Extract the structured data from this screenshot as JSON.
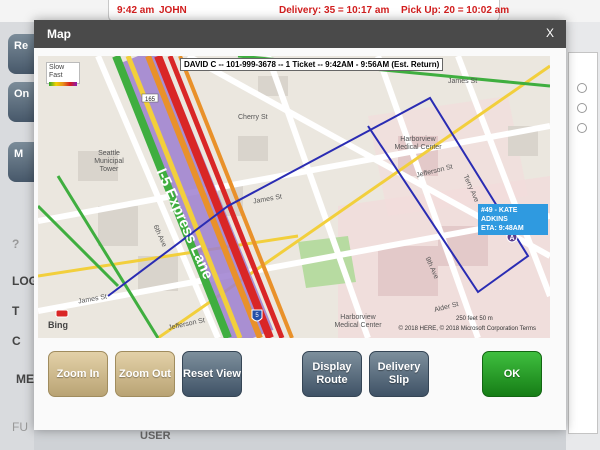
{
  "topbar": {
    "time": "9:42 am",
    "user": "JOHN",
    "delivery": "Delivery: 35 = 10:17 am",
    "pickup": "Pick Up: 20 = 10:02 am"
  },
  "background": {
    "btn1": "Re",
    "btn2": "On",
    "btn3": "M",
    "question": "?",
    "lbl_log": "LOG",
    "lbl_t": "T",
    "lbl_c": "C",
    "lbl_me": "ME",
    "lbl_fu": "FU",
    "bottom": "USER"
  },
  "modal": {
    "title": "Map",
    "close": "X"
  },
  "map": {
    "driver_label": "DAVID C -- 101-999-3678 -- 1 Ticket -- 9:42AM - 9:56AM (Est. Return)",
    "traffic_label": "Slow Fast",
    "eta_line1": "#49 - KATE ADKINS",
    "eta_line2": "ETA: 9:48AM",
    "marker": "A",
    "bing": "Bing",
    "copyright": "© 2018 HERE, © 2018 Microsoft Corporation  Terms",
    "scale": "250 feet        50 m",
    "streets": {
      "express": "I-5 Express Lane",
      "cherry": "Cherry St",
      "james_top": "James St",
      "james_mid": "James St",
      "james_bot": "James St",
      "jefferson": "Jefferson St",
      "jefferson_bot": "Jefferson St",
      "alder": "Alder St",
      "sixth": "6th Ave",
      "ninth": "9th Ave",
      "terry": "Terry Ave",
      "harborview": "Harborview Medical Center",
      "harborview2": "Harborview Medical Center",
      "tower": "Seattle Municipal Tower"
    },
    "shields": {
      "i5": "5",
      "r165": "165"
    }
  },
  "buttons": {
    "zoom_in": "Zoom In",
    "zoom_out": "Zoom Out",
    "reset_view": "Reset View",
    "display_route": "Display Route",
    "delivery_slip": "Delivery Slip",
    "ok": "OK"
  }
}
